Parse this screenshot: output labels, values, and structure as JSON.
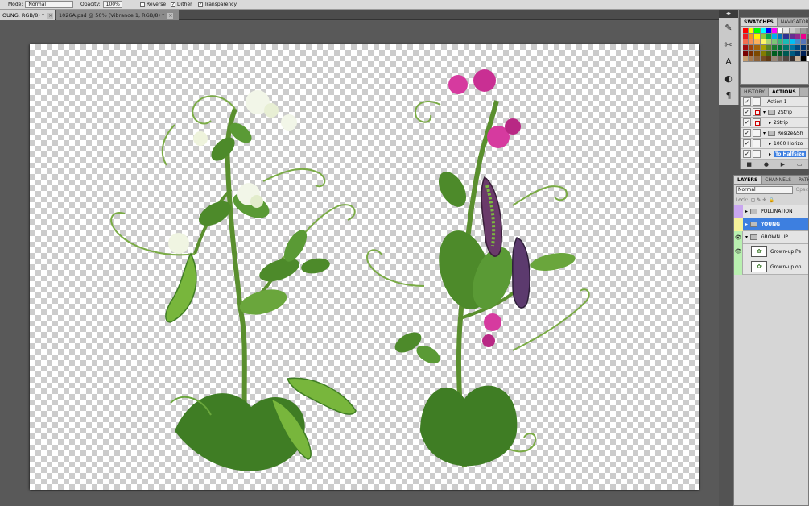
{
  "options_bar": {
    "mode_label": "Mode:",
    "mode_value": "Normal",
    "opacity_label": "Opacity:",
    "opacity_value": "100%",
    "reverse_label": "Reverse",
    "dither_label": "Dither",
    "transparency_label": "Transparency"
  },
  "tabs": [
    {
      "label": "OUNG, RGB/8) *",
      "active": true
    },
    {
      "label": "1026A.psd @ 50% (Vibrance 1, RGB/8) *",
      "active": false
    }
  ],
  "tab_close_glyph": "×",
  "panels": {
    "swatches_tab": "SWATCHES",
    "navigator_tab": "NAVIGATOR",
    "history_tab": "HISTORY",
    "actions_tab": "ACTIONS",
    "layers_tab": "LAYERS",
    "channels_tab": "CHANNELS",
    "paths_tab": "PATH",
    "blend_mode": "Normal",
    "opacity_short": "Opac",
    "lock_label": "Lock:"
  },
  "actions": [
    {
      "label": "Action 1"
    },
    {
      "label": "2Strip"
    },
    {
      "label": "2Strip"
    },
    {
      "label": "Resize&Sh"
    },
    {
      "label": "1000 Horizo"
    },
    {
      "label": "To Halfsize"
    }
  ],
  "layers": [
    {
      "name": "POLLINATION",
      "color": "#c9a6f0"
    },
    {
      "name": "YOUNG",
      "color": "#f6f29a"
    },
    {
      "name": "GROWN UP",
      "color": "#b9f0b0"
    },
    {
      "name": "Grown-up Pe",
      "color": "#b9f0b0"
    },
    {
      "name": "Grown-up on",
      "color": "#b9f0b0"
    }
  ],
  "swatch_colors": [
    [
      "#ff0000",
      "#ffff00",
      "#00ff00",
      "#00ffff",
      "#0000ff",
      "#ff00ff",
      "#ffffff",
      "#e6e6e6",
      "#cccccc",
      "#b3b3b3",
      "#999999",
      "#808080"
    ],
    [
      "#ed1c24",
      "#f7941d",
      "#fff200",
      "#8dc63f",
      "#00a651",
      "#00aeef",
      "#0072bc",
      "#2e3192",
      "#662d91",
      "#92278f",
      "#ec008c",
      "#666666"
    ],
    [
      "#f26c4f",
      "#f68e55",
      "#fbaf5c",
      "#fff467",
      "#acd372",
      "#7cc576",
      "#3bb878",
      "#1abbb4",
      "#00bff3",
      "#438cca",
      "#5574b9",
      "#4d4d4d"
    ],
    [
      "#9e0b0f",
      "#a0410d",
      "#a3620a",
      "#aba000",
      "#598527",
      "#1a7b30",
      "#007236",
      "#00746b",
      "#0076a3",
      "#004b80",
      "#003471",
      "#333333"
    ],
    [
      "#790000",
      "#7b2e00",
      "#7d4900",
      "#827b00",
      "#406618",
      "#005e20",
      "#005826",
      "#005952",
      "#005b7f",
      "#003663",
      "#002157",
      "#1a1a1a"
    ],
    [
      "#c69c6d",
      "#a67c52",
      "#8c6239",
      "#754c24",
      "#603913",
      "#998675",
      "#736357",
      "#534741",
      "#362f2d",
      "#c7b299",
      "#000000",
      "#ffffff"
    ]
  ]
}
